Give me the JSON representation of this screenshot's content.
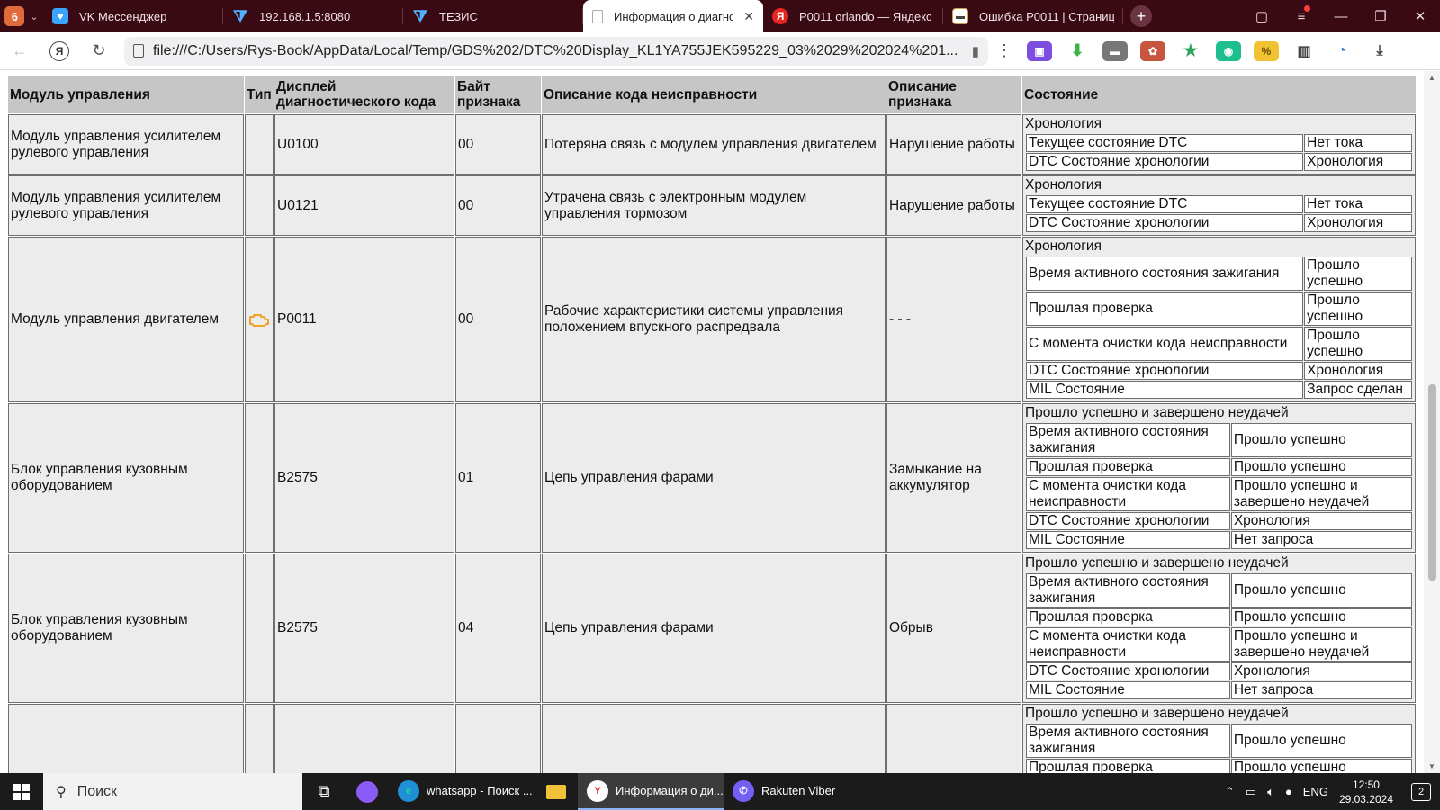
{
  "browser": {
    "tab_count": "6",
    "tabs": [
      {
        "label": "VK Мессенджер",
        "icon": "vk-icon"
      },
      {
        "label": "192.168.1.5:8080",
        "icon": "funnel-icon"
      },
      {
        "label": "ТЕЗИС",
        "icon": "funnel-icon"
      },
      {
        "label": "Информация о диагнос",
        "icon": "document-icon",
        "active": true
      },
      {
        "label": "P0011 orlando — Яндекс",
        "icon": "yandex-icon"
      },
      {
        "label": "Ошибка P0011 | Страница",
        "icon": "garage-icon"
      }
    ],
    "url": "file:///C:/Users/Rys-Book/AppData/Local/Temp/GDS%202/DTC%20Display_KL1YA755JEK595229_03%2029%202024%201..."
  },
  "table": {
    "headers": {
      "module": "Модуль управления",
      "type": "Тип",
      "code": "Дисплей диагностического кода",
      "byte": "Байт признака",
      "desc": "Описание кода неисправности",
      "sym": "Описание признака",
      "state": "Состояние"
    },
    "rows": [
      {
        "module": "Модуль управления усилителем рулевого управления",
        "code": "U0100",
        "byte": "00",
        "desc": "Потеряна связь с модулем управления двигателем",
        "sym": "Нарушение работы",
        "state_title": "Хронология",
        "state_rows": [
          [
            "Текущее состояние DTC",
            "Нет тока"
          ],
          [
            "DTC Состояние хронологии",
            "Хронология"
          ]
        ]
      },
      {
        "module": "Модуль управления усилителем рулевого управления",
        "code": "U0121",
        "byte": "00",
        "desc": "Утрачена связь с электронным модулем управления тормозом",
        "sym": "Нарушение работы",
        "state_title": "Хронология",
        "state_rows": [
          [
            "Текущее состояние DTC",
            "Нет тока"
          ],
          [
            "DTC Состояние хронологии",
            "Хронология"
          ]
        ]
      },
      {
        "module": "Модуль управления двигателем",
        "mil": true,
        "code": "P0011",
        "byte": "00",
        "desc": "Рабочие характеристики системы управления положением впускного распредвала",
        "sym": "- - -",
        "state_title": "Хронология",
        "state_rows": [
          [
            "Время активного состояния зажигания",
            "Прошло успешно"
          ],
          [
            "Прошлая проверка",
            "Прошло успешно"
          ],
          [
            "С момента очистки кода неисправности",
            "Прошло успешно"
          ],
          [
            "DTC Состояние хронологии",
            "Хронология"
          ],
          [
            "MIL Состояние",
            "Запрос сделан"
          ]
        ]
      },
      {
        "module": "Блок управления кузовным оборудованием",
        "code": "B2575",
        "byte": "01",
        "desc": "Цепь управления фарами",
        "sym": "Замыкание на аккумулятор",
        "state_title": "Прошло успешно и завершено неудачей",
        "state_rows": [
          [
            "Время активного состояния зажигания",
            "Прошло успешно"
          ],
          [
            "Прошлая проверка",
            "Прошло успешно"
          ],
          [
            "С момента очистки кода неисправности",
            "Прошло успешно и завершено неудачей"
          ],
          [
            "DTC Состояние хронологии",
            "Хронология"
          ],
          [
            "MIL Состояние",
            "Нет запроса"
          ]
        ]
      },
      {
        "module": "Блок управления кузовным оборудованием",
        "code": "B2575",
        "byte": "04",
        "desc": "Цепь управления фарами",
        "sym": "Обрыв",
        "state_title": "Прошло успешно и завершено неудачей",
        "state_rows": [
          [
            "Время активного состояния зажигания",
            "Прошло успешно"
          ],
          [
            "Прошлая проверка",
            "Прошло успешно"
          ],
          [
            "С момента очистки кода неисправности",
            "Прошло успешно и завершено неудачей"
          ],
          [
            "DTC Состояние хронологии",
            "Хронология"
          ],
          [
            "MIL Состояние",
            "Нет запроса"
          ]
        ]
      },
      {
        "module": "",
        "code": "",
        "byte": "",
        "desc": "",
        "sym": "",
        "state_title": "Прошло успешно и завершено неудачей",
        "state_rows": [
          [
            "Время активного состояния зажигания",
            "Прошло успешно"
          ],
          [
            "Прошлая проверка",
            "Прошло успешно"
          ]
        ]
      }
    ]
  },
  "taskbar": {
    "search_placeholder": "Поиск",
    "apps": [
      {
        "label": "whatsapp - Поиск ...",
        "icon": "edge-icon"
      },
      {
        "label": "",
        "icon": "folder-icon"
      },
      {
        "label": "Информация о ди...",
        "icon": "yandex-browser-icon",
        "active": true
      },
      {
        "label": "Rakuten Viber",
        "icon": "viber-icon"
      }
    ],
    "lang": "ENG",
    "time": "12:50",
    "date": "29.03.2024",
    "notifications": "2"
  }
}
